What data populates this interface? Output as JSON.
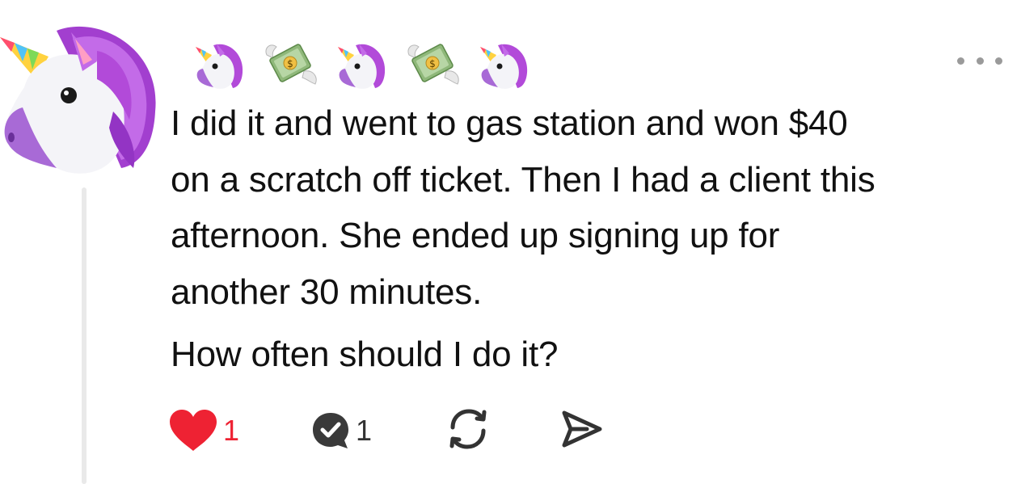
{
  "post": {
    "text_lines": [
      "I did it and went to gas station and won $40",
      "on a scratch off ticket. Then I had a client this",
      "afternoon. She ended up signing up for",
      "another 30 minutes."
    ],
    "question": "How often should I do it?",
    "emoji_sequence": [
      "unicorn",
      "money-with-wings",
      "unicorn",
      "money-with-wings",
      "unicorn"
    ]
  },
  "actions": {
    "like_count": "1",
    "reply_count": "1"
  },
  "colors": {
    "like": "#ee2233",
    "reply_bubble": "#3a3a3a",
    "icon_stroke": "#333333",
    "more_dots": "#9a9a9a",
    "unicorn_mane": "#b24ad9",
    "money_green": "#8fb87a"
  }
}
